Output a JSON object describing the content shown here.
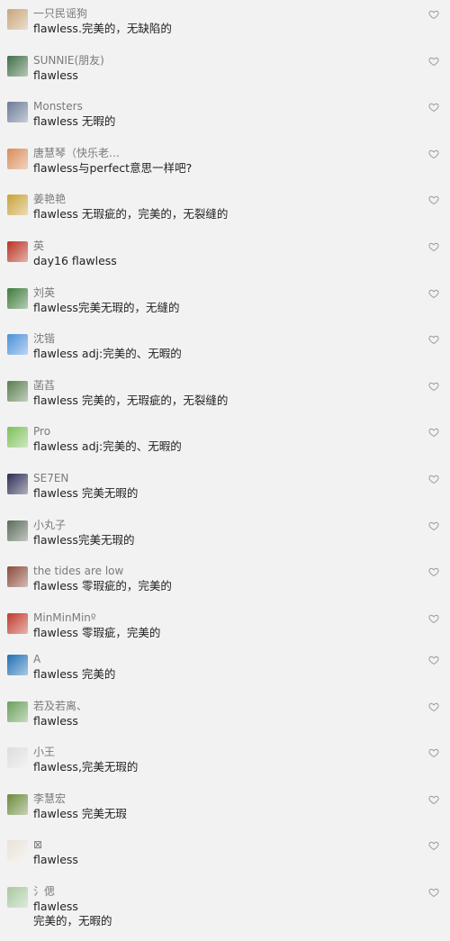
{
  "comments": [
    {
      "name": "一只民谣狗",
      "text": "flawless.完美的，无缺陷的",
      "avatar_color": "#c8a57a",
      "icon": "dog-avatar"
    },
    {
      "name": "SUNNIE(朋友)",
      "text": "flawless",
      "avatar_color": "#3f6e45",
      "icon": "landscape-avatar"
    },
    {
      "name": "Monsters",
      "text": "flawless 无暇的",
      "avatar_color": "#6b7a96",
      "icon": "person-avatar"
    },
    {
      "name": "唐慧琴（快乐老…",
      "text": "flawless与perfect意思一样吧?",
      "avatar_color": "#d88c5a",
      "icon": "flower-avatar"
    },
    {
      "name": "姜艳艳",
      "text": "flawless 无瑕疵的，完美的，无裂缝的",
      "avatar_color": "#c9a23a",
      "icon": "gold-avatar"
    },
    {
      "name": "英",
      "text": "day16 flawless",
      "avatar_color": "#b8321f",
      "icon": "fire-avatar"
    },
    {
      "name": "刘英",
      "text": "flawless完美无瑕的，无缝的",
      "avatar_color": "#3c7a3a",
      "icon": "leaf-avatar"
    },
    {
      "name": "沈锴",
      "text": "flawless   adj:完美的、无暇的",
      "avatar_color": "#4a90d9",
      "icon": "cartoon-avatar"
    },
    {
      "name": "菡萏",
      "text": "flawless 完美的，无瑕疵的，无裂缝的",
      "avatar_color": "#5b7d4f",
      "icon": "garden-avatar"
    },
    {
      "name": "Pro",
      "text": "flawless   adj:完美的、无暇的",
      "avatar_color": "#7cc05a",
      "icon": "dino-avatar"
    },
    {
      "name": "SE7EN",
      "text": "flawless 完美无暇的",
      "avatar_color": "#2c2c54",
      "icon": "galaxy-avatar"
    },
    {
      "name": "小丸子",
      "text": "flawless完美无瑕的",
      "avatar_color": "#5a6b5a",
      "icon": "group-avatar"
    },
    {
      "name": "the tides are low",
      "text": "flawless 零瑕疵的，完美的",
      "avatar_color": "#8a4a3a",
      "icon": "portrait-avatar"
    },
    {
      "name": "MinMinMinº",
      "text": "flawless 零瑕疵，完美的",
      "avatar_color": "#c0392b",
      "icon": "girl-avatar"
    },
    {
      "name": "A",
      "text": "flawless 完美的",
      "avatar_color": "#1f6fb5",
      "icon": "sea-avatar"
    },
    {
      "name": "若及若离、",
      "text": "flawless",
      "avatar_color": "#6aa05a",
      "icon": "woman-avatar"
    },
    {
      "name": "小王",
      "text": "flawless,完美无瑕的",
      "avatar_color": "#dddddd",
      "icon": "sketch-avatar"
    },
    {
      "name": "李慧宏",
      "text": "flawless 完美无瑕",
      "avatar_color": "#6b8a3a",
      "icon": "outdoor-avatar"
    },
    {
      "name": "⊠",
      "text": "flawless",
      "avatar_color": "#e8e2d8",
      "icon": "cup-avatar"
    },
    {
      "name": "氵偲",
      "text": "flawless",
      "text2": "完美的，无暇的",
      "avatar_color": "#a8c8a0",
      "icon": "fan-avatar"
    }
  ],
  "colors": {
    "background": "#f2f2f2",
    "name": "#7a7a7a",
    "text": "#222222",
    "icon": "#999999"
  }
}
